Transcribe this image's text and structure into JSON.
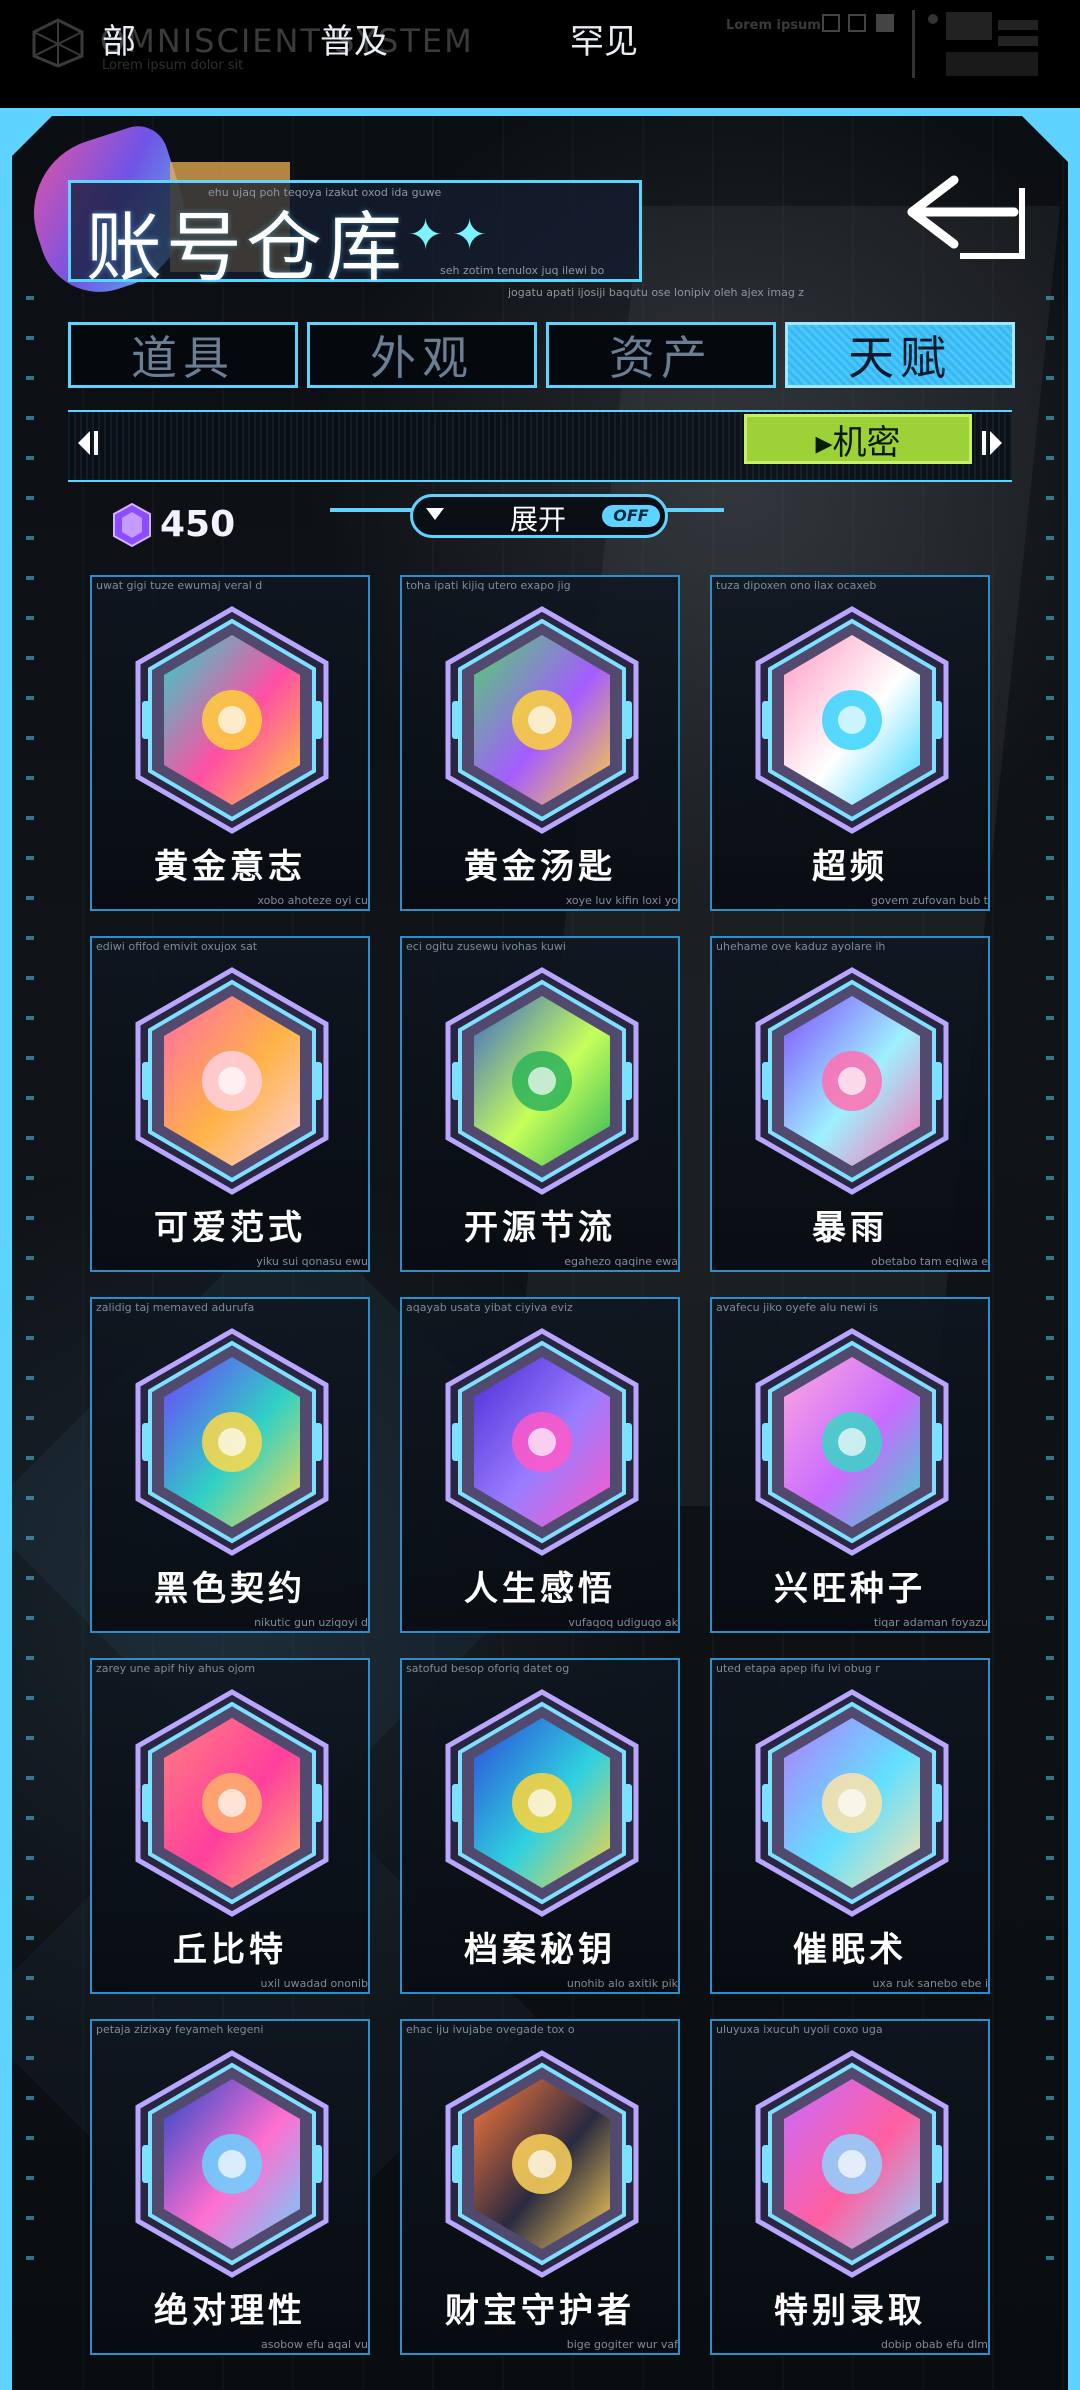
{
  "topbar": {
    "brand": "OMNISCIENT SYSTEM",
    "brand_sub": "Lorem ipsum dolor sit",
    "ipsum": "Lorem ipsum"
  },
  "title": {
    "text": "账号仓库",
    "star_glyph": "✦",
    "caption_top": "ehu ujaq poh teqoya izakut oxod ida guwe",
    "caption_right": "seh zotim tenulox juq ilewi bo",
    "caption_under": "jogatu apati ijosiji baqutu ose lonipiv oleh ajex imag z"
  },
  "tabs": [
    {
      "label": "道具",
      "active": false
    },
    {
      "label": "外观",
      "active": false
    },
    {
      "label": "资产",
      "active": false
    },
    {
      "label": "天赋",
      "active": true
    }
  ],
  "filters": {
    "items": [
      "部",
      "普及",
      "罕见"
    ],
    "active": "▸机密"
  },
  "currency": {
    "value": "450"
  },
  "expand": {
    "label": "展开",
    "toggle": "OFF"
  },
  "cards": [
    {
      "name": "黄金意志",
      "cap_top": "uwat gigi tuze ewumaj veral d",
      "cap_bot": "xobo ahoteze oyi cu",
      "icon": "golden-sun-icon",
      "colors": [
        "#28d6c8",
        "#ffcf3a",
        "#ff4fa3"
      ]
    },
    {
      "name": "黄金汤匙",
      "cap_top": "toha ipati kijiq utero exapo jig",
      "cap_bot": "xoye luv kifin loxi yo",
      "icon": "golden-spoon-icon",
      "colors": [
        "#4fd36b",
        "#ffd23a",
        "#a45cff"
      ]
    },
    {
      "name": "超频",
      "cap_top": "tuza dipoxen ono ilax ocaxeb",
      "cap_bot": "govem zufovan bub t",
      "icon": "overclock-chip-icon",
      "colors": [
        "#ff9ac2",
        "#38d4ff",
        "#ffffff"
      ]
    },
    {
      "name": "可爱范式",
      "cap_top": "ediwi ofifod emivit oxujox sat",
      "cap_bot": "yiku sui qonasu ewu",
      "icon": "bunny-icon",
      "colors": [
        "#ff6aa8",
        "#ffd0e0",
        "#ffb347"
      ]
    },
    {
      "name": "开源节流",
      "cap_top": "eci ogitu zusewu ivohas kuwi",
      "cap_bot": "egahezo qaqine ewa",
      "icon": "money-cards-icon",
      "colors": [
        "#3b66c9",
        "#2bb35a",
        "#c6ff5a"
      ]
    },
    {
      "name": "暴雨",
      "cap_top": "uhehame ove kaduz ayolare ih",
      "cap_bot": "obetabo tam eqiwa e",
      "icon": "rain-cloud-icon",
      "colors": [
        "#7f4dff",
        "#ff6fb0",
        "#9ef0ff"
      ]
    },
    {
      "name": "黑色契约",
      "cap_top": "zalidig taj memaved adurufa",
      "cap_bot": "nikutic gun uziqoyi d",
      "icon": "contract-icon",
      "colors": [
        "#6f3dff",
        "#ffd84a",
        "#2fd1c5"
      ]
    },
    {
      "name": "人生感悟",
      "cap_top": "aqayab usata yibat ciyiva eviz",
      "cap_bot": "vufaqoq udiguqo ak",
      "icon": "winding-path-icon",
      "colors": [
        "#4b2bd6",
        "#ff58c8",
        "#9a7dff"
      ]
    },
    {
      "name": "兴旺种子",
      "cap_top": "avafecu jiko oyefe alu newi is",
      "cap_bot": "tiqar adaman foyazu",
      "icon": "flower-seed-icon",
      "colors": [
        "#ffa8e0",
        "#3ad6c6",
        "#c86bff"
      ]
    },
    {
      "name": "丘比特",
      "cap_top": "zarey une apif hiy ahus ojom",
      "cap_bot": "uxil uwadad ononib",
      "icon": "cupid-bow-icon",
      "colors": [
        "#ff7f7f",
        "#ffb26b",
        "#ff3f9d"
      ]
    },
    {
      "name": "档案秘钥",
      "cap_top": "satofud besop oforiq datet og",
      "cap_bot": "unohib alo axitik pik",
      "icon": "golden-key-icon",
      "colors": [
        "#2e49d8",
        "#ffd43a",
        "#2fd1e0"
      ]
    },
    {
      "name": "催眠术",
      "cap_top": "uted etapa apep ifu ivi obug r",
      "cap_bot": "uxa ruk sanebo ebe i",
      "icon": "hypno-spiral-icon",
      "colors": [
        "#b07cff",
        "#ffe3a8",
        "#63e0ff"
      ]
    },
    {
      "name": "绝对理性",
      "cap_top": "petaja zizixay feyameh kegeni",
      "cap_bot": "asobow efu aqal vu",
      "icon": "brain-head-icon",
      "colors": [
        "#2647c9",
        "#6ad2ff",
        "#ff6fd0"
      ]
    },
    {
      "name": "财宝守护者",
      "cap_top": "ehac iju ivujabe ovegade tox o",
      "cap_bot": "bige gogiter wur vaf",
      "icon": "penguin-guard-icon",
      "colors": [
        "#ff7a3a",
        "#ffd35a",
        "#2a2a40"
      ]
    },
    {
      "name": "特别录取",
      "cap_top": "uluyuxa ixucuh uyoli coxo uga",
      "cap_bot": "dobip obab efu dlm",
      "icon": "admission-letter-icon",
      "colors": [
        "#c76bff",
        "#8fd3ff",
        "#ff5fa0"
      ]
    }
  ]
}
